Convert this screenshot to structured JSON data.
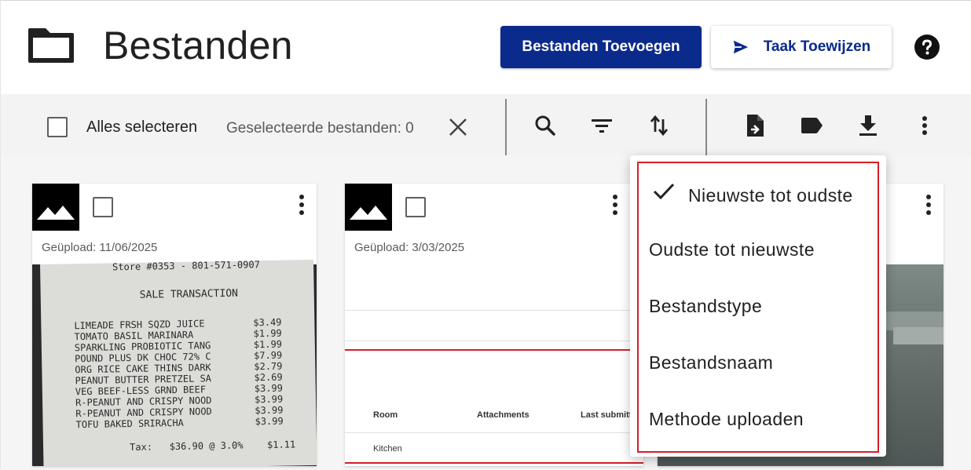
{
  "header": {
    "title": "Bestanden",
    "add_files_label": "Bestanden Toevoegen",
    "assign_task_label": "Taak Toewijzen",
    "brand_color": "#0a2a8c"
  },
  "toolbar": {
    "select_all_label": "Alles selecteren",
    "selected_count": "Geselecteerde bestanden: 0",
    "icons": [
      "search-icon",
      "filter-icon",
      "sort-icon",
      "file-export-icon",
      "label-icon",
      "download-icon",
      "more-vert-icon"
    ]
  },
  "cards": [
    {
      "upload_date": "Geüpload: 11/06/2025",
      "receipt": {
        "store_line": "Store #0353 - 801-571-0907",
        "heading": "SALE TRANSACTION",
        "items": [
          {
            "name": "LIMEADE FRSH SQZD JUICE",
            "price": "$3.49"
          },
          {
            "name": "TOMATO BASIL MARINARA",
            "price": "$1.99"
          },
          {
            "name": "SPARKLING PROBIOTIC TANG",
            "price": "$1.99"
          },
          {
            "name": "POUND PLUS DK CHOC 72% C",
            "price": "$7.99"
          },
          {
            "name": "ORG RICE CAKE THINS DARK",
            "price": "$2.79"
          },
          {
            "name": "PEANUT BUTTER PRETZEL SA",
            "price": "$2.69"
          },
          {
            "name": "VEG BEEF-LESS GRND BEEF",
            "price": "$3.99"
          },
          {
            "name": "R-PEANUT AND CRISPY NOOD",
            "price": "$3.99"
          },
          {
            "name": "R-PEANUT AND CRISPY NOOD",
            "price": "$3.99"
          },
          {
            "name": "TOFU BAKED SRIRACHA",
            "price": "$3.99"
          }
        ],
        "tax_line": "Tax:   $36.90 @ 3.0%",
        "tax_amount": "$1.11"
      }
    },
    {
      "upload_date": "Geüpload: 3/03/2025",
      "table": {
        "headers": [
          "Room",
          "Attachments",
          "Last submitt"
        ],
        "rows": [
          [
            "Kitchen"
          ]
        ]
      }
    },
    {
      "upload_date": ""
    }
  ],
  "sort_menu": {
    "selected_index": 0,
    "items": [
      "Nieuwste tot oudste",
      "Oudste tot nieuwste",
      "Bestandstype",
      "Bestandsnaam",
      "Methode uploaden"
    ],
    "highlight_color": "#d51f26"
  }
}
